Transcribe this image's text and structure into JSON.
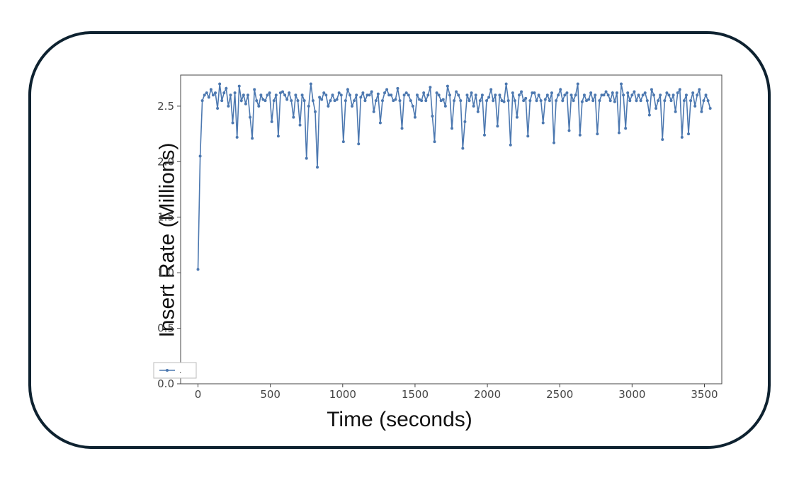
{
  "chart_data": {
    "type": "line",
    "xlabel": "Time (seconds)",
    "ylabel": "Insert Rate (Millions)",
    "xlim": [
      -120,
      3620
    ],
    "ylim": [
      0.0,
      2.78
    ],
    "xticks": [
      0,
      500,
      1000,
      1500,
      2000,
      2500,
      3000,
      3500
    ],
    "yticks": [
      0.0,
      0.5,
      1.0,
      1.5,
      2.0,
      2.5
    ],
    "legend": {
      "label": "."
    },
    "series": [
      {
        "name": ".",
        "color": "#4c78b0",
        "x": [
          0,
          15,
          30,
          45,
          60,
          75,
          90,
          105,
          120,
          135,
          150,
          165,
          180,
          195,
          210,
          225,
          240,
          255,
          270,
          285,
          300,
          315,
          330,
          345,
          360,
          375,
          390,
          405,
          420,
          435,
          450,
          465,
          480,
          495,
          510,
          525,
          540,
          555,
          570,
          585,
          600,
          615,
          630,
          645,
          660,
          675,
          690,
          705,
          720,
          735,
          750,
          765,
          780,
          795,
          810,
          825,
          840,
          855,
          870,
          885,
          900,
          915,
          930,
          945,
          960,
          975,
          990,
          1005,
          1020,
          1035,
          1050,
          1065,
          1080,
          1095,
          1110,
          1125,
          1140,
          1155,
          1170,
          1185,
          1200,
          1215,
          1230,
          1245,
          1260,
          1275,
          1290,
          1305,
          1320,
          1335,
          1350,
          1365,
          1380,
          1395,
          1410,
          1425,
          1440,
          1455,
          1470,
          1485,
          1500,
          1515,
          1530,
          1545,
          1560,
          1575,
          1590,
          1605,
          1620,
          1635,
          1650,
          1665,
          1680,
          1695,
          1710,
          1725,
          1740,
          1755,
          1770,
          1785,
          1800,
          1815,
          1830,
          1845,
          1860,
          1875,
          1890,
          1905,
          1920,
          1935,
          1950,
          1965,
          1980,
          1995,
          2010,
          2025,
          2040,
          2055,
          2070,
          2085,
          2100,
          2115,
          2130,
          2145,
          2160,
          2175,
          2190,
          2205,
          2220,
          2235,
          2250,
          2265,
          2280,
          2295,
          2310,
          2325,
          2340,
          2355,
          2370,
          2385,
          2400,
          2415,
          2430,
          2445,
          2460,
          2475,
          2490,
          2505,
          2520,
          2535,
          2550,
          2565,
          2580,
          2595,
          2610,
          2625,
          2640,
          2655,
          2670,
          2685,
          2700,
          2715,
          2730,
          2745,
          2760,
          2775,
          2790,
          2805,
          2820,
          2835,
          2850,
          2865,
          2880,
          2895,
          2910,
          2925,
          2940,
          2955,
          2970,
          2985,
          3000,
          3015,
          3030,
          3045,
          3060,
          3075,
          3090,
          3105,
          3120,
          3135,
          3150,
          3165,
          3180,
          3195,
          3210,
          3225,
          3240,
          3255,
          3270,
          3285,
          3300,
          3315,
          3330,
          3345,
          3360,
          3375,
          3390,
          3405,
          3420,
          3435,
          3450,
          3465,
          3480,
          3495,
          3510,
          3525,
          3540
        ],
        "values": [
          1.03,
          2.05,
          2.55,
          2.6,
          2.62,
          2.58,
          2.65,
          2.6,
          2.62,
          2.48,
          2.7,
          2.55,
          2.62,
          2.66,
          2.5,
          2.6,
          2.35,
          2.62,
          2.22,
          2.68,
          2.55,
          2.6,
          2.52,
          2.6,
          2.4,
          2.21,
          2.65,
          2.55,
          2.5,
          2.6,
          2.56,
          2.55,
          2.6,
          2.62,
          2.36,
          2.55,
          2.6,
          2.23,
          2.62,
          2.63,
          2.6,
          2.56,
          2.62,
          2.55,
          2.4,
          2.6,
          2.55,
          2.33,
          2.6,
          2.55,
          2.03,
          2.5,
          2.7,
          2.55,
          2.45,
          1.95,
          2.58,
          2.56,
          2.62,
          2.6,
          2.5,
          2.55,
          2.6,
          2.55,
          2.56,
          2.62,
          2.6,
          2.18,
          2.55,
          2.65,
          2.6,
          2.5,
          2.55,
          2.6,
          2.16,
          2.58,
          2.62,
          2.55,
          2.6,
          2.6,
          2.63,
          2.45,
          2.55,
          2.61,
          2.35,
          2.55,
          2.62,
          2.65,
          2.6,
          2.6,
          2.55,
          2.56,
          2.66,
          2.55,
          2.3,
          2.6,
          2.62,
          2.6,
          2.55,
          2.5,
          2.4,
          2.6,
          2.56,
          2.55,
          2.62,
          2.55,
          2.6,
          2.67,
          2.41,
          2.18,
          2.62,
          2.6,
          2.55,
          2.56,
          2.5,
          2.68,
          2.6,
          2.3,
          2.55,
          2.63,
          2.6,
          2.55,
          2.12,
          2.36,
          2.6,
          2.55,
          2.62,
          2.5,
          2.6,
          2.45,
          2.55,
          2.6,
          2.24,
          2.55,
          2.58,
          2.65,
          2.55,
          2.6,
          2.32,
          2.6,
          2.55,
          2.54,
          2.7,
          2.55,
          2.15,
          2.62,
          2.55,
          2.4,
          2.6,
          2.63,
          2.55,
          2.57,
          2.23,
          2.55,
          2.62,
          2.62,
          2.55,
          2.6,
          2.55,
          2.35,
          2.56,
          2.6,
          2.55,
          2.62,
          2.17,
          2.55,
          2.6,
          2.65,
          2.55,
          2.6,
          2.62,
          2.28,
          2.6,
          2.55,
          2.6,
          2.7,
          2.24,
          2.54,
          2.6,
          2.55,
          2.56,
          2.62,
          2.55,
          2.6,
          2.25,
          2.55,
          2.6,
          2.6,
          2.63,
          2.6,
          2.55,
          2.62,
          2.54,
          2.62,
          2.26,
          2.7,
          2.6,
          2.3,
          2.62,
          2.55,
          2.6,
          2.63,
          2.55,
          2.6,
          2.55,
          2.6,
          2.62,
          2.55,
          2.42,
          2.65,
          2.6,
          2.48,
          2.55,
          2.6,
          2.2,
          2.55,
          2.62,
          2.6,
          2.55,
          2.6,
          2.45,
          2.62,
          2.65,
          2.22,
          2.55,
          2.6,
          2.25,
          2.55,
          2.62,
          2.5,
          2.6,
          2.65,
          2.45,
          2.55,
          2.6,
          2.55,
          2.48
        ]
      }
    ]
  }
}
